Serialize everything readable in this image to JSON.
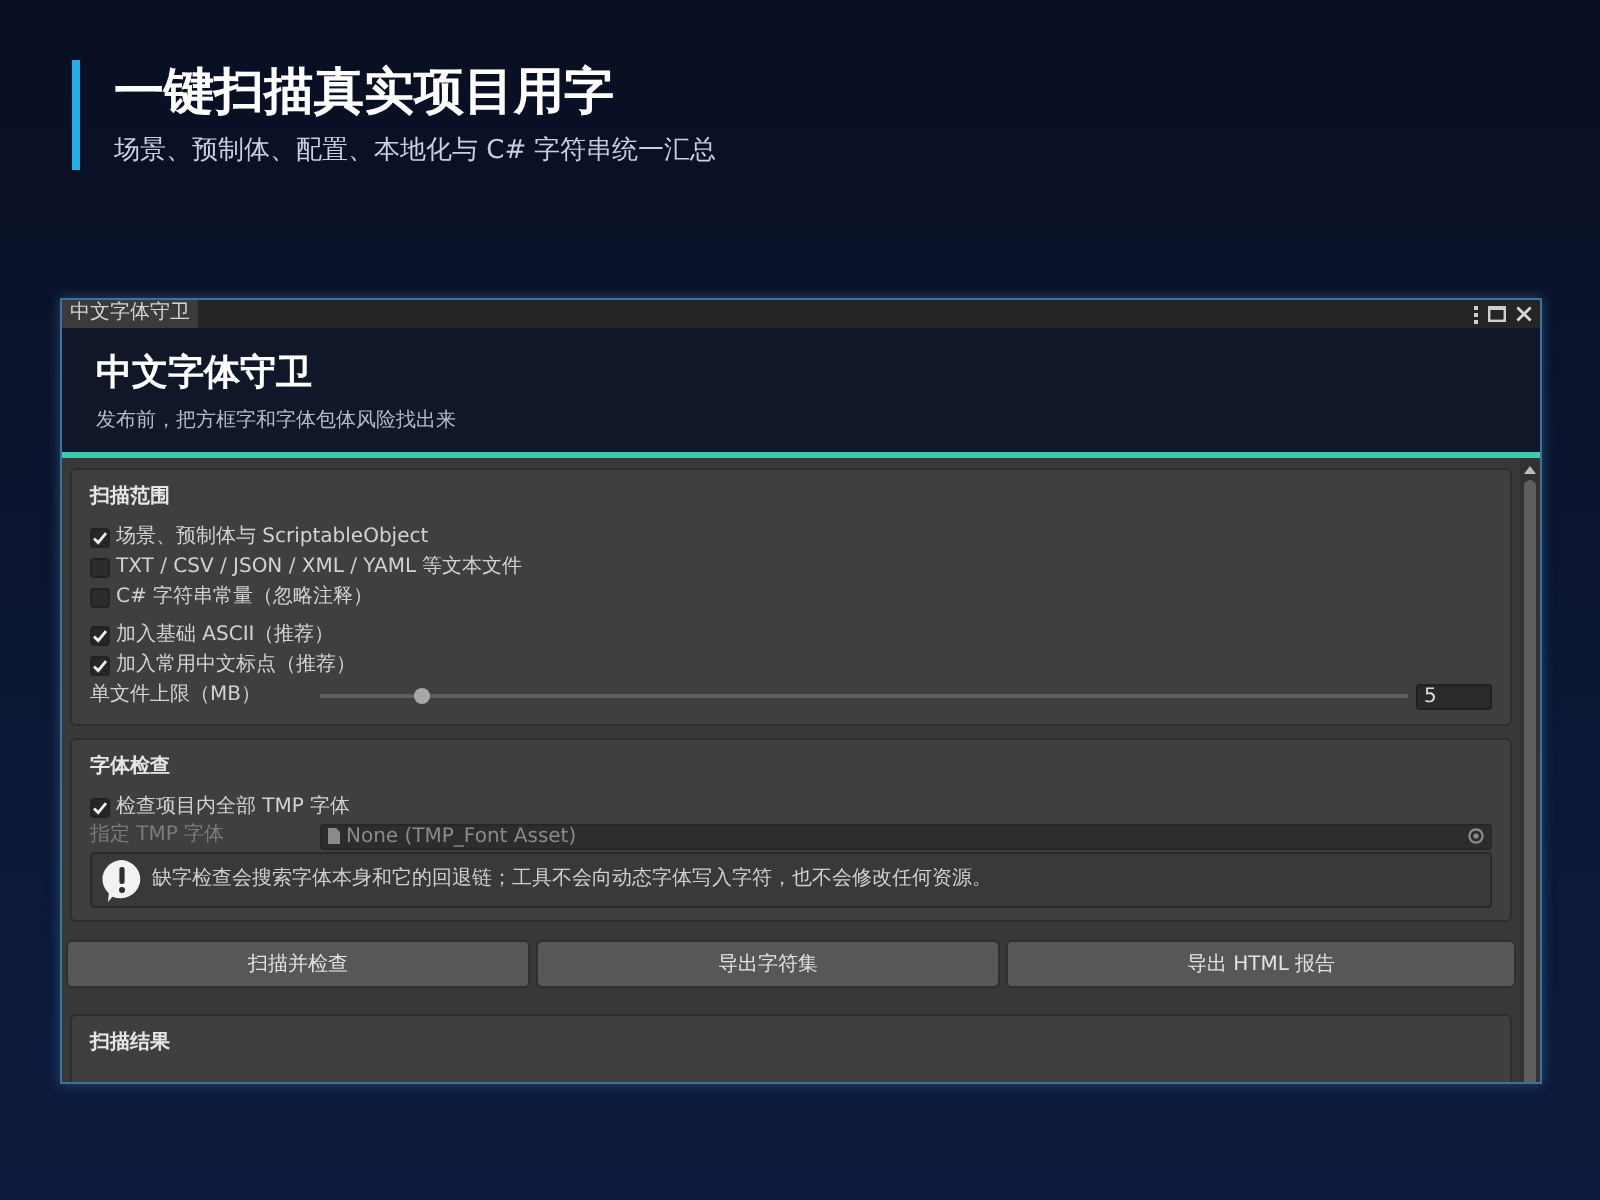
{
  "header": {
    "title": "一键扫描真实项目用字",
    "subtitle": "场景、预制体、配置、本地化与 C# 字符串统一汇总"
  },
  "window": {
    "tab": "中文字体守卫",
    "heading": "中文字体守卫",
    "subtitle": "发布前，把方框字和字体包体风险找出来"
  },
  "scan_range": {
    "title": "扫描范围",
    "sources": [
      {
        "label": "场景、预制体与 ScriptableObject",
        "checked": true
      },
      {
        "label": "TXT / CSV / JSON / XML / YAML 等文本文件",
        "checked": false
      },
      {
        "label": "C# 字符串常量（忽略注释）",
        "checked": false
      }
    ],
    "extras": [
      {
        "label": "加入基础 ASCII（推荐）",
        "checked": true
      },
      {
        "label": "加入常用中文标点（推荐）",
        "checked": true
      }
    ],
    "size_limit": {
      "label": "单文件上限（MB）",
      "level": 0.087,
      "value": "5"
    }
  },
  "font_check": {
    "title": "字体检查",
    "options": [
      {
        "label": "检查项目内全部 TMP 字体",
        "checked": true
      }
    ],
    "font_field": {
      "label": "指定 TMP 字体",
      "value": "None (TMP_Font Asset)",
      "disabled": true
    },
    "help": "缺字检查会搜索字体本身和它的回退链；工具不会向动态字体写入字符，也不会修改任何资源。"
  },
  "buttons": [
    "扫描并检查",
    "导出字符集",
    "导出 HTML 报告"
  ],
  "results": {
    "title": "扫描结果"
  }
}
